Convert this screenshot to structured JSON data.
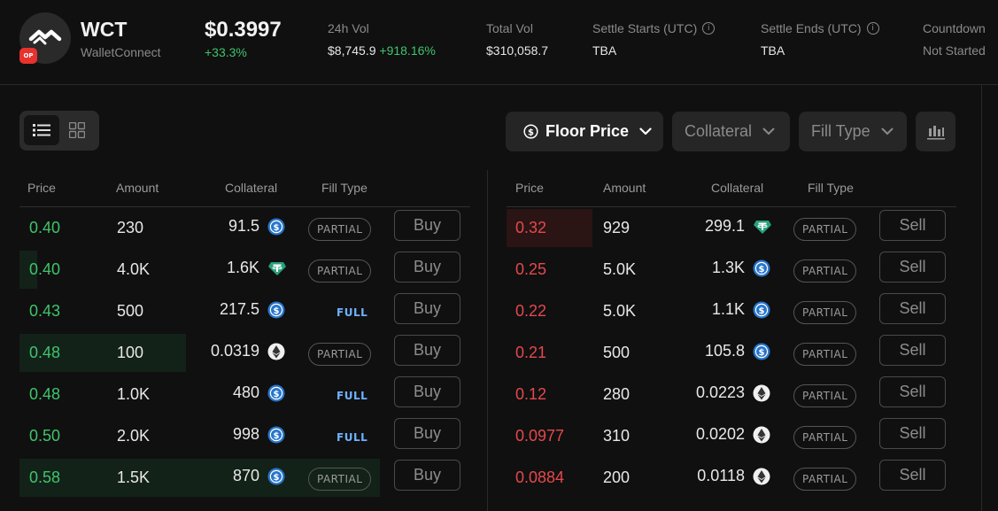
{
  "header": {
    "symbol": "WCT",
    "name": "WalletConnect",
    "op_badge": "OP",
    "price": "$0.3997",
    "change": "+33.3%",
    "stats": [
      {
        "label": "24h Vol",
        "value": "$8,745.9",
        "value_change": "+918.16%",
        "info": false
      },
      {
        "label": "Total Vol",
        "value": "$310,058.7",
        "value_change": "",
        "info": false
      },
      {
        "label": "Settle Starts (UTC)",
        "value": "TBA",
        "value_change": "",
        "info": true
      },
      {
        "label": "Settle Ends (UTC)",
        "value": "TBA",
        "value_change": "",
        "info": true
      },
      {
        "label": "Countdown",
        "value": "Not Started",
        "value_change": "",
        "info": false
      }
    ]
  },
  "filters": {
    "floor_price": "Floor Price",
    "collateral": "Collateral",
    "fill_type": "Fill Type"
  },
  "columns": {
    "price": "Price",
    "amount": "Amount",
    "collateral": "Collateral",
    "fill_type": "Fill Type"
  },
  "buy_orders": [
    {
      "price": "0.40",
      "amount": "230",
      "collateral": "91.5",
      "coin": "usdc",
      "fill": "PARTIAL",
      "action": "Buy",
      "depth": 0
    },
    {
      "price": "0.40",
      "amount": "4.0K",
      "collateral": "1.6K",
      "coin": "usdt",
      "fill": "PARTIAL",
      "action": "Buy",
      "depth": 0.04
    },
    {
      "price": "0.43",
      "amount": "500",
      "collateral": "217.5",
      "coin": "usdc",
      "fill": "FULL",
      "action": "Buy",
      "depth": 0
    },
    {
      "price": "0.48",
      "amount": "100",
      "collateral": "0.0319",
      "coin": "eth",
      "fill": "PARTIAL",
      "action": "Buy",
      "depth": 0.37
    },
    {
      "price": "0.48",
      "amount": "1.0K",
      "collateral": "480",
      "coin": "usdc",
      "fill": "FULL",
      "action": "Buy",
      "depth": 0
    },
    {
      "price": "0.50",
      "amount": "2.0K",
      "collateral": "998",
      "coin": "usdc",
      "fill": "FULL",
      "action": "Buy",
      "depth": 0
    },
    {
      "price": "0.58",
      "amount": "1.5K",
      "collateral": "870",
      "coin": "usdc",
      "fill": "PARTIAL",
      "action": "Buy",
      "depth": 0.8
    }
  ],
  "sell_orders": [
    {
      "price": "0.32",
      "amount": "929",
      "collateral": "299.1",
      "coin": "usdt",
      "fill": "PARTIAL",
      "action": "Sell",
      "depth": 0.19
    },
    {
      "price": "0.25",
      "amount": "5.0K",
      "collateral": "1.3K",
      "coin": "usdc",
      "fill": "PARTIAL",
      "action": "Sell",
      "depth": 0
    },
    {
      "price": "0.22",
      "amount": "5.0K",
      "collateral": "1.1K",
      "coin": "usdc",
      "fill": "PARTIAL",
      "action": "Sell",
      "depth": 0
    },
    {
      "price": "0.21",
      "amount": "500",
      "collateral": "105.8",
      "coin": "usdc",
      "fill": "PARTIAL",
      "action": "Sell",
      "depth": 0
    },
    {
      "price": "0.12",
      "amount": "280",
      "collateral": "0.0223",
      "coin": "eth",
      "fill": "PARTIAL",
      "action": "Sell",
      "depth": 0
    },
    {
      "price": "0.0977",
      "amount": "310",
      "collateral": "0.0202",
      "coin": "eth",
      "fill": "PARTIAL",
      "action": "Sell",
      "depth": 0
    },
    {
      "price": "0.0884",
      "amount": "200",
      "collateral": "0.0118",
      "coin": "eth",
      "fill": "PARTIAL",
      "action": "Sell",
      "depth": 0
    }
  ],
  "colors": {
    "up": "#3fc46b",
    "down": "#e5484d",
    "usdc": "#2775ca",
    "usdt": "#26a17b",
    "full_badge": "#6db3ff"
  }
}
